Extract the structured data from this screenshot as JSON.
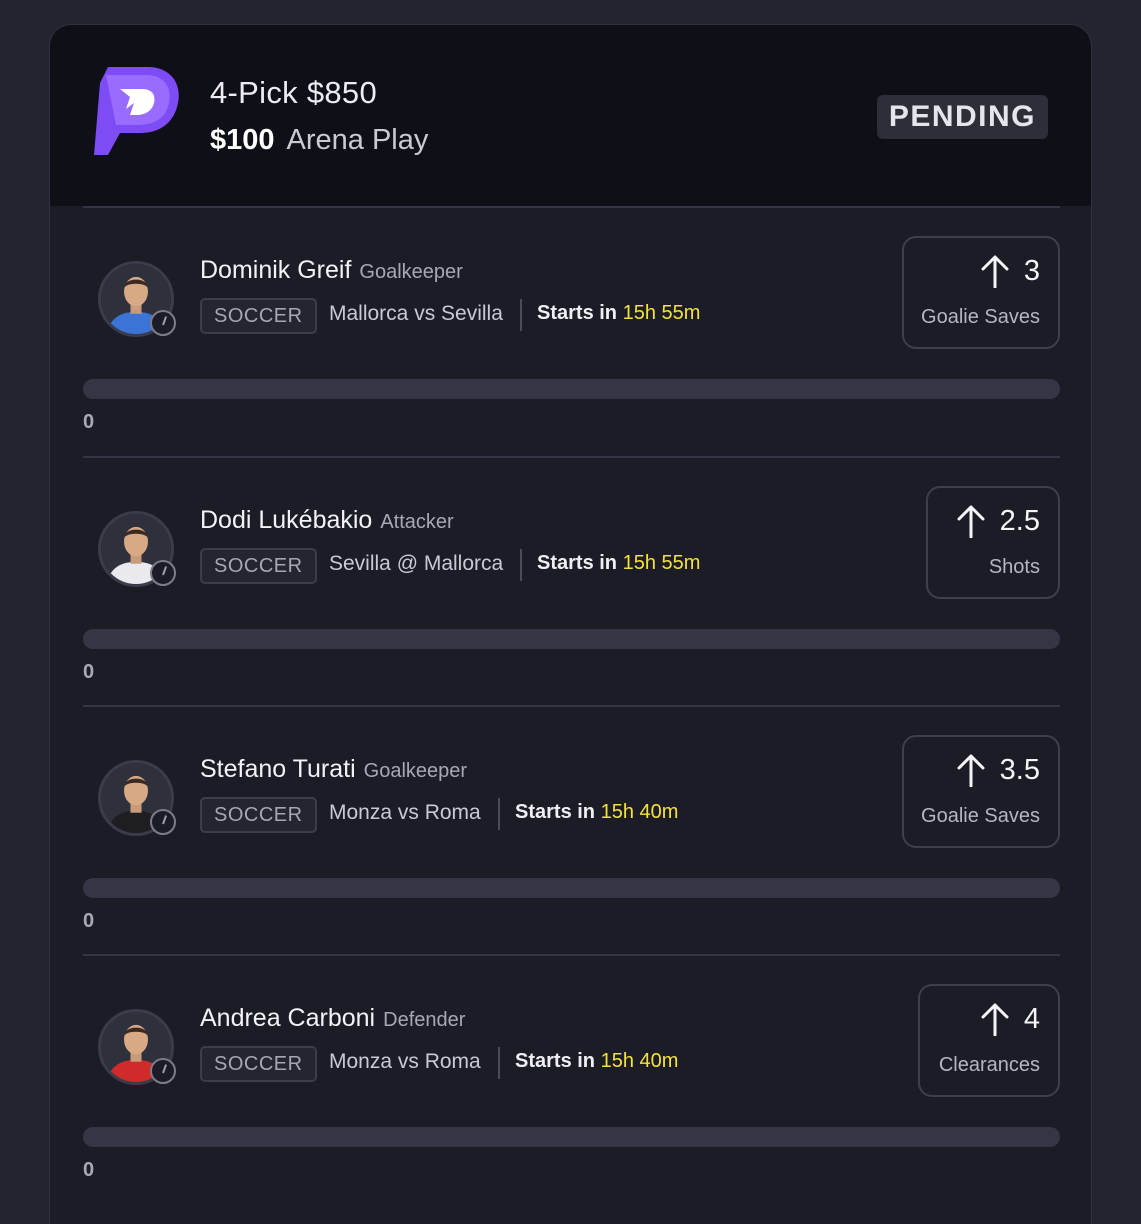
{
  "entry": {
    "title": "4-Pick $850",
    "stake": "$100",
    "play_type": "Arena Play",
    "status": "PENDING",
    "brand_color": "#7d4cf5"
  },
  "picks": [
    {
      "name": "Dominik Greif",
      "position": "Goalkeeper",
      "sport": "SOCCER",
      "matchup": "Mallorca vs Sevilla",
      "starts_label": "Starts in",
      "starts_time": "15h 55m",
      "direction": "up",
      "line": "3",
      "stat": "Goalie Saves",
      "progress_value": "0",
      "progress_fraction": 0,
      "jersey_color": "#3b74d6"
    },
    {
      "name": "Dodi Lukébakio",
      "position": "Attacker",
      "sport": "SOCCER",
      "matchup": "Sevilla @ Mallorca",
      "starts_label": "Starts in",
      "starts_time": "15h 55m",
      "direction": "up",
      "line": "2.5",
      "stat": "Shots",
      "progress_value": "0",
      "progress_fraction": 0,
      "jersey_color": "#e9e9ee"
    },
    {
      "name": "Stefano Turati",
      "position": "Goalkeeper",
      "sport": "SOCCER",
      "matchup": "Monza vs Roma",
      "starts_label": "Starts in",
      "starts_time": "15h 40m",
      "direction": "up",
      "line": "3.5",
      "stat": "Goalie Saves",
      "progress_value": "0",
      "progress_fraction": 0,
      "jersey_color": "#1e1e22"
    },
    {
      "name": "Andrea Carboni",
      "position": "Defender",
      "sport": "SOCCER",
      "matchup": "Monza vs Roma",
      "starts_label": "Starts in",
      "starts_time": "15h 40m",
      "direction": "up",
      "line": "4",
      "stat": "Clearances",
      "progress_value": "0",
      "progress_fraction": 0,
      "jersey_color": "#d12a2a"
    }
  ]
}
